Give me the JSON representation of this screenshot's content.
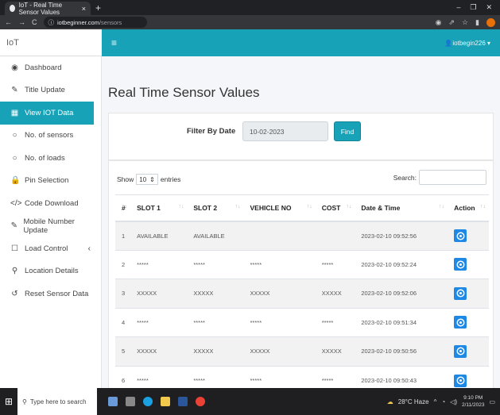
{
  "browser": {
    "tab_title": "IoT - Real Time Sensor Values",
    "tab_close": "×",
    "new_tab": "+",
    "url_host": "iotbeginner.com",
    "url_path": "/sensors",
    "controls": {
      "minimize": "–",
      "maximize": "❐",
      "close": "✕"
    }
  },
  "header": {
    "brand": "IoT",
    "menu_toggle": "≡",
    "user": "iotbegin226 ▾"
  },
  "sidebar": {
    "items": [
      {
        "icon": "dashboard-icon",
        "glyph": "◉",
        "label": "Dashboard"
      },
      {
        "icon": "edit-icon",
        "glyph": "✎",
        "label": "Title Update"
      },
      {
        "icon": "table-icon",
        "glyph": "▦",
        "label": "View IOT Data"
      },
      {
        "icon": "circle-icon",
        "glyph": "○",
        "label": "No. of sensors"
      },
      {
        "icon": "circle-icon",
        "glyph": "○",
        "label": "No. of loads"
      },
      {
        "icon": "lock-icon",
        "glyph": "🔒",
        "label": "Pin Selection"
      },
      {
        "icon": "code-icon",
        "glyph": "</>",
        "label": "Code Download"
      },
      {
        "icon": "edit-icon",
        "glyph": "✎",
        "label": "Mobile Number Update"
      },
      {
        "icon": "square-icon",
        "glyph": "☐",
        "label": "Load Control",
        "chevron": "‹"
      },
      {
        "icon": "location-pin-icon",
        "glyph": "⚲",
        "label": "Location Details"
      },
      {
        "icon": "undo-icon",
        "glyph": "↺",
        "label": "Reset Sensor Data"
      }
    ],
    "active_index": 2
  },
  "page": {
    "title": "Real Time Sensor Values",
    "filter": {
      "label": "Filter By Date",
      "date_value": "10-02-2023",
      "button": "Find"
    },
    "table_controls": {
      "show_label": "Show",
      "entries_value": "10",
      "entries_label": "entries",
      "search_label": "Search:"
    },
    "columns": [
      "#",
      "SLOT 1",
      "SLOT 2",
      "VEHICLE NO",
      "COST",
      "Date & Time",
      "Action"
    ],
    "rows": [
      [
        "1",
        "AVAILABLE",
        "AVAILABLE",
        "",
        "",
        "2023-02-10 09:52:56"
      ],
      [
        "2",
        "*****",
        "*****",
        "*****",
        "*****",
        "2023-02-10 09:52:24"
      ],
      [
        "3",
        "XXXXX",
        "XXXXX",
        "XXXXX",
        "XXXXX",
        "2023-02-10 09:52:06"
      ],
      [
        "4",
        "*****",
        "*****",
        "*****",
        "*****",
        "2023-02-10 09:51:34"
      ],
      [
        "5",
        "XXXXX",
        "XXXXX",
        "XXXXX",
        "XXXXX",
        "2023-02-10 09:50:56"
      ],
      [
        "6",
        "*****",
        "*****",
        "*****",
        "*****",
        "2023-02-10 09:50:43"
      ]
    ]
  },
  "taskbar": {
    "search_placeholder": "Type here to search",
    "weather": "28°C Haze",
    "time": "9:10 PM",
    "date": "2/11/2023"
  }
}
